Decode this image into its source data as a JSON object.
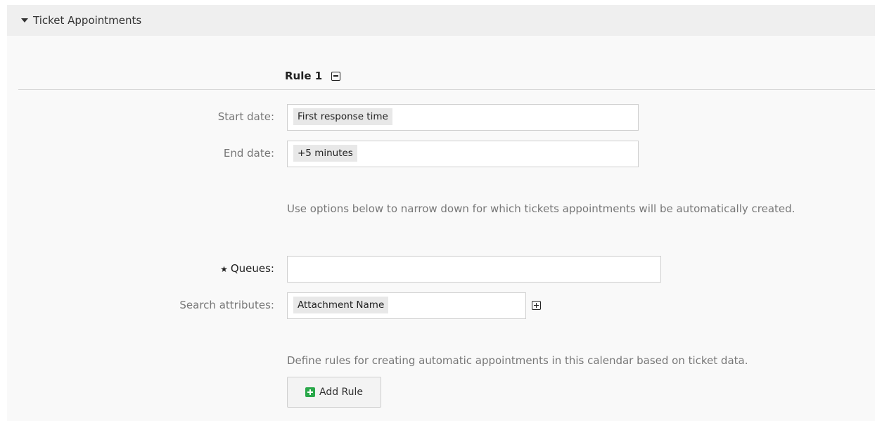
{
  "panel": {
    "title": "Ticket Appointments",
    "collapse_icon": "caret-down-icon"
  },
  "rule": {
    "heading": "Rule 1",
    "remove_icon": "minus-square-icon"
  },
  "fields": {
    "start_date": {
      "label": "Start date:",
      "value": "First response time"
    },
    "end_date": {
      "label": "End date:",
      "value": "+5 minutes"
    },
    "queues": {
      "label": "Queues:",
      "value": "",
      "required_marker": "★"
    },
    "search_attributes": {
      "label": "Search attributes:",
      "value": "Attachment Name",
      "add_icon": "plus-square-icon"
    }
  },
  "help": {
    "narrow_options": "Use options below to narrow down for which tickets appointments will be automatically created.",
    "define_rules": "Define rules for creating automatic appointments in this calendar based on ticket data."
  },
  "actions": {
    "add_rule_label": "Add Rule",
    "add_rule_icon": "plus-green-icon"
  }
}
